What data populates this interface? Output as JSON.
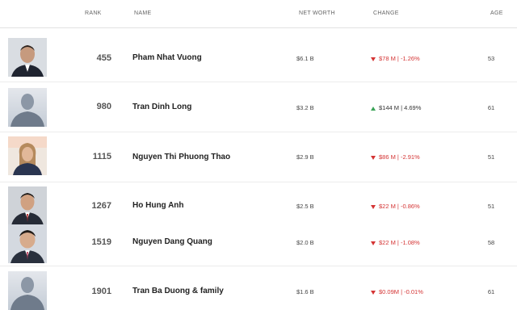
{
  "headers": {
    "rank": "RANK",
    "name": "NAME",
    "net_worth": "NET WORTH",
    "change": "CHANGE",
    "age": "AGE"
  },
  "rows": [
    {
      "rank": "455",
      "name": "Pham Nhat Vuong",
      "net_worth": "$6.1 B",
      "change": "$78 M | -1.26%",
      "direction": "down",
      "age": "53",
      "photo": "portrait"
    },
    {
      "rank": "980",
      "name": "Tran Dinh Long",
      "net_worth": "$3.2 B",
      "change": "$144 M | 4.69%",
      "direction": "up",
      "age": "61",
      "photo": "placeholder"
    },
    {
      "rank": "1115",
      "name": "Nguyen Thi Phuong Thao",
      "net_worth": "$2.9 B",
      "change": "$86 M | -2.91%",
      "direction": "down",
      "age": "51",
      "photo": "portrait"
    },
    {
      "rank": "1267",
      "name": "Ho Hung Anh",
      "net_worth": "$2.5 B",
      "change": "$22 M | -0.86%",
      "direction": "down",
      "age": "51",
      "photo": "portrait"
    },
    {
      "rank": "1519",
      "name": "Nguyen Dang Quang",
      "net_worth": "$2.0 B",
      "change": "$22 M | -1.08%",
      "direction": "down",
      "age": "58",
      "photo": "portrait"
    },
    {
      "rank": "1901",
      "name": "Tran Ba Duong & family",
      "net_worth": "$1.6 B",
      "change": "$0.09M | -0.01%",
      "direction": "down",
      "age": "61",
      "photo": "placeholder"
    }
  ],
  "colors": {
    "down": "#d43434",
    "up": "#3aa357"
  }
}
